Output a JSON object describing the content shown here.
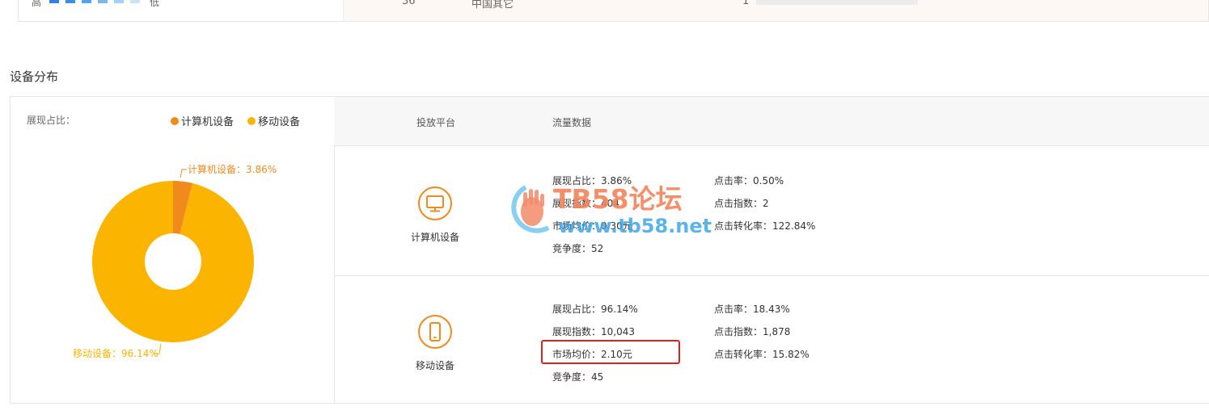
{
  "top": {
    "legend_high": "高",
    "legend_low": "低",
    "swatch_colors": [
      "#2f80e4",
      "#3a8ee6",
      "#55a2ef",
      "#78b8f2",
      "#a3d0f7",
      "#c8e3fb"
    ],
    "rank": "36",
    "region": "中国其它",
    "count": "1"
  },
  "section": {
    "title": "设备分布"
  },
  "left_panel": {
    "share_label": "展现占比：",
    "legend": [
      {
        "label": "计算机设备",
        "color": "#f08a1c"
      },
      {
        "label": "移动设备",
        "color": "#fbb400"
      }
    ]
  },
  "chart_data": {
    "type": "pie",
    "donut": true,
    "categories": [
      "计算机设备",
      "移动设备"
    ],
    "values": [
      3.86,
      96.14
    ],
    "colors": [
      "#f08a1c",
      "#fbb400"
    ],
    "slice_labels": [
      "计算机设备：3.86%",
      "移动设备：96.14%"
    ],
    "legend_position": "top-right"
  },
  "table": {
    "headers": {
      "platform": "投放平台",
      "traffic": "流量数据"
    },
    "rows": [
      {
        "device": "计算机设备",
        "icon": "monitor-icon",
        "left_stats": [
          "展现占比：3.86%",
          "展现指数：404",
          "市场均价：0.30元",
          "竞争度：52"
        ],
        "right_stats": [
          "点击率：0.50%",
          "点击指数：2",
          "点击转化率：122.84%"
        ]
      },
      {
        "device": "移动设备",
        "icon": "phone-icon",
        "left_stats": [
          "展现占比：96.14%",
          "展现指数：10,043",
          "市场均价：2.10元",
          "竞争度：45"
        ],
        "right_stats": [
          "点击率：18.43%",
          "点击指数：1,878",
          "点击转化率：15.82%"
        ]
      }
    ]
  },
  "watermark": {
    "brand": "TB58论坛",
    "url": "www.tb58.net"
  },
  "colors": {
    "accent_orange": "#f08a1c",
    "accent_yellow": "#fbb400",
    "highlight_red": "#e02020"
  }
}
